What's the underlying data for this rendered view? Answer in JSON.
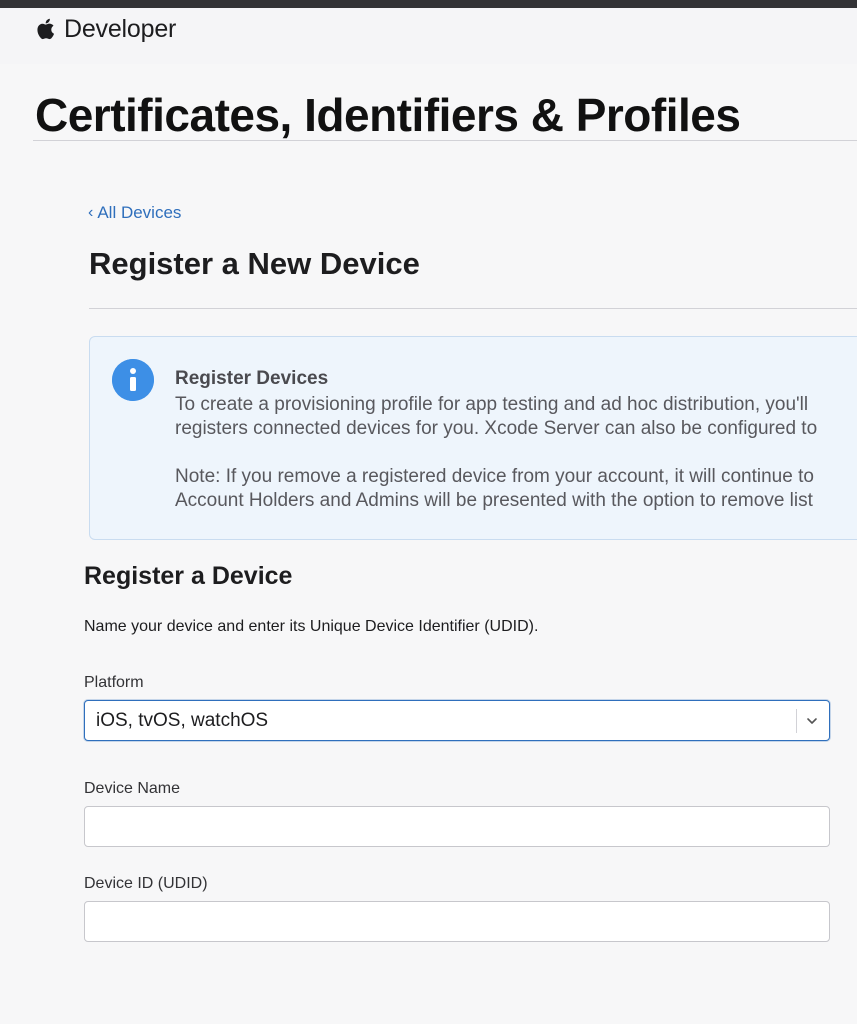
{
  "header": {
    "apple_logo_icon": "apple-logo-icon",
    "brand": "Developer"
  },
  "page": {
    "title": "Certificates, Identifiers & Profiles"
  },
  "nav": {
    "back_chevron": "‹",
    "back_label": "All Devices"
  },
  "section": {
    "title": "Register a New Device"
  },
  "info": {
    "icon": "info-icon",
    "title": "Register Devices",
    "lines": [
      "To create a provisioning profile for app testing and ad hoc distribution, you'll",
      "registers connected devices for you. Xcode Server can also be configured to",
      "Note: If you remove a registered device from your account, it will continue to",
      "Account Holders and Admins will be presented with the option to remove list"
    ]
  },
  "form": {
    "title": "Register a Device",
    "description": "Name your device and enter its Unique Device Identifier (UDID).",
    "platform": {
      "label": "Platform",
      "selected": "iOS, tvOS, watchOS"
    },
    "device_name": {
      "label": "Device Name",
      "value": "",
      "placeholder": ""
    },
    "device_id": {
      "label": "Device ID (UDID)",
      "value": "",
      "placeholder": ""
    }
  },
  "colors": {
    "link": "#2f6fbc",
    "info_background": "#eef5fc",
    "info_icon": "#3d8fe6"
  }
}
